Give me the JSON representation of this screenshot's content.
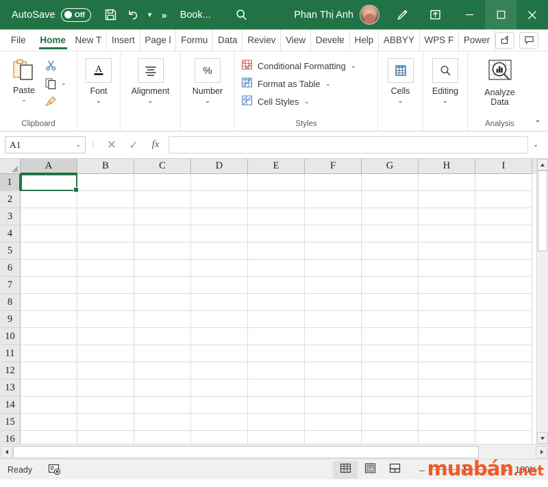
{
  "titlebar": {
    "autosave_label": "AutoSave",
    "autosave_state": "Off",
    "save_icon": "save-floppy-icon",
    "undo_icon": "undo-arrow-icon",
    "qat_more": "»",
    "doc_title": "Book...",
    "search_icon": "search-magnifier-icon",
    "user_name": "Phan Thị Anh",
    "avatar": "user-avatar",
    "ink_icon": "pen-ink-icon",
    "ribbon_display_icon": "ribbon-display-options-icon",
    "minimize": "–",
    "maximize": "☐",
    "close": "✕",
    "bg_color": "#217346"
  },
  "tabs": [
    {
      "label": "File",
      "active": false
    },
    {
      "label": "Home",
      "active": true
    },
    {
      "label": "New T",
      "active": false
    },
    {
      "label": "Insert",
      "active": false
    },
    {
      "label": "Page l",
      "active": false
    },
    {
      "label": "Formu",
      "active": false
    },
    {
      "label": "Data",
      "active": false
    },
    {
      "label": "Reviev",
      "active": false
    },
    {
      "label": "View",
      "active": false
    },
    {
      "label": "Develɐ",
      "active": false
    },
    {
      "label": "Help",
      "active": false
    },
    {
      "label": "ABBYY",
      "active": false
    },
    {
      "label": "WPS F",
      "active": false
    },
    {
      "label": "Power",
      "active": false
    }
  ],
  "tabstrip_right": {
    "share_icon": "share-icon",
    "comments_icon": "comments-icon"
  },
  "ribbon": {
    "clipboard": {
      "group_label": "Clipboard",
      "paste_label": "Paste",
      "paste_chevron": "⌄",
      "cut_icon": "scissors-cut-icon",
      "copy_icon": "copy-icon",
      "copy_chevron": "⌄",
      "format_painter_icon": "format-painter-brush-icon",
      "dialog_launcher": "⤵"
    },
    "font": {
      "label": "Font",
      "icon": "font-A-icon",
      "chevron": "⌄"
    },
    "alignment": {
      "label": "Alignment",
      "icon": "alignment-lines-icon",
      "chevron": "⌄"
    },
    "number": {
      "label": "Number",
      "icon": "percent-icon",
      "chevron": "⌄"
    },
    "styles": {
      "group_label": "Styles",
      "items": [
        {
          "label": "Conditional Formatting",
          "icon": "conditional-formatting-icon",
          "chevron": "⌄"
        },
        {
          "label": "Format as Table",
          "icon": "format-as-table-icon",
          "chevron": "⌄"
        },
        {
          "label": "Cell Styles",
          "icon": "cell-styles-icon",
          "chevron": "⌄"
        }
      ]
    },
    "cells": {
      "label": "Cells",
      "icon": "cells-table-icon",
      "chevron": "⌄"
    },
    "editing": {
      "label": "Editing",
      "icon": "editing-magnifier-icon",
      "chevron": "⌄"
    },
    "analysis": {
      "group_label": "Analysis",
      "label_line1": "Analyze",
      "label_line2": "Data",
      "icon": "analyze-data-icon"
    },
    "collapse_chevron": "⌃"
  },
  "formulabar": {
    "namebox_value": "A1",
    "namebox_chevron": "⌄",
    "cancel_icon": "✕",
    "enter_icon": "✓",
    "function_icon": "fx",
    "input_value": "",
    "expand_chevron": "⌄"
  },
  "grid": {
    "columns": [
      "A",
      "B",
      "C",
      "D",
      "E",
      "F",
      "G",
      "H",
      "I"
    ],
    "rows": [
      "1",
      "2",
      "3",
      "4",
      "5",
      "6",
      "7",
      "8",
      "9",
      "10",
      "11",
      "12",
      "13",
      "14",
      "15",
      "16"
    ],
    "selected_cell": "A1",
    "selected_column": "A",
    "selected_row": "1"
  },
  "scrollbars": {
    "v_up": "▲",
    "v_down": "▼",
    "h_left": "◀",
    "h_right": "▶"
  },
  "statusbar": {
    "status_text": "Ready",
    "macro_icon": "record-macro-icon",
    "views": [
      {
        "name": "normal-view",
        "icon": "grid-view-icon",
        "active": true
      },
      {
        "name": "page-layout-view",
        "icon": "page-layout-icon",
        "active": false
      },
      {
        "name": "page-break-view",
        "icon": "page-break-icon",
        "active": false
      }
    ],
    "zoom_out": "–",
    "zoom_in": "+",
    "zoom_percent": "100%"
  },
  "watermark": {
    "main": "muabán",
    "suffix": ".net"
  }
}
